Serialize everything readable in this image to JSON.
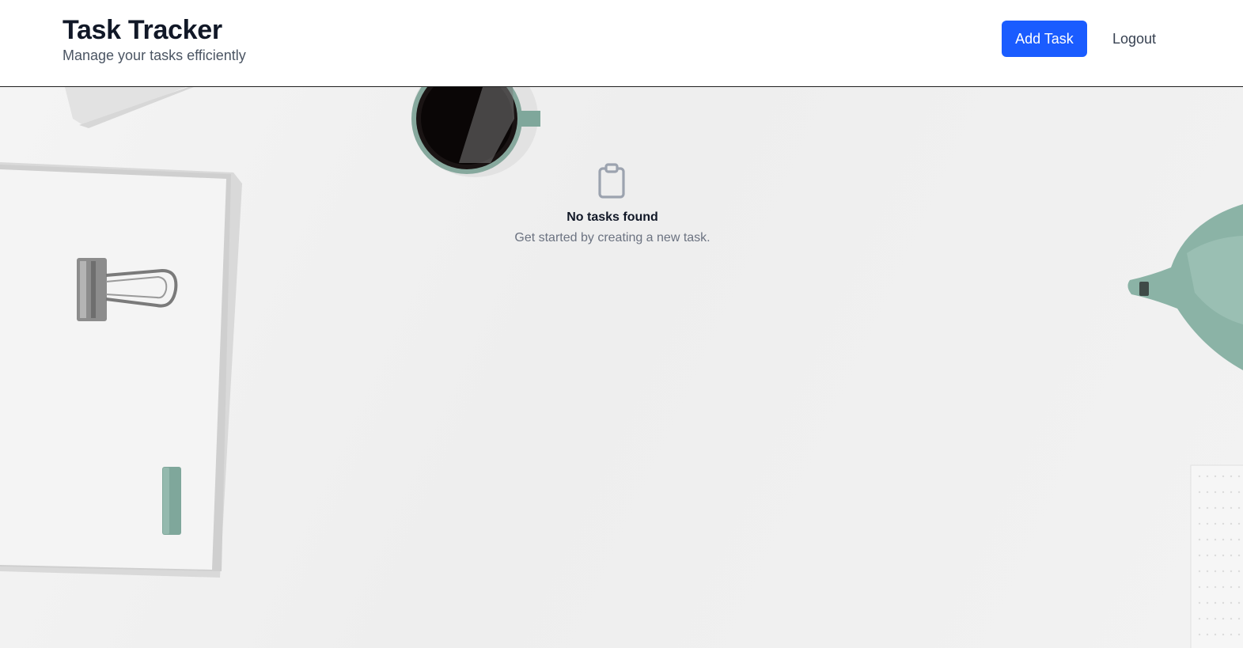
{
  "header": {
    "title": "Task Tracker",
    "subtitle": "Manage your tasks efficiently",
    "add_label": "Add Task",
    "logout_label": "Logout"
  },
  "empty_state": {
    "icon": "clipboard-icon",
    "title": "No tasks found",
    "description": "Get started by creating a new task."
  },
  "colors": {
    "accent": "#1a5cff",
    "title": "#111827",
    "muted": "#6b7280"
  }
}
